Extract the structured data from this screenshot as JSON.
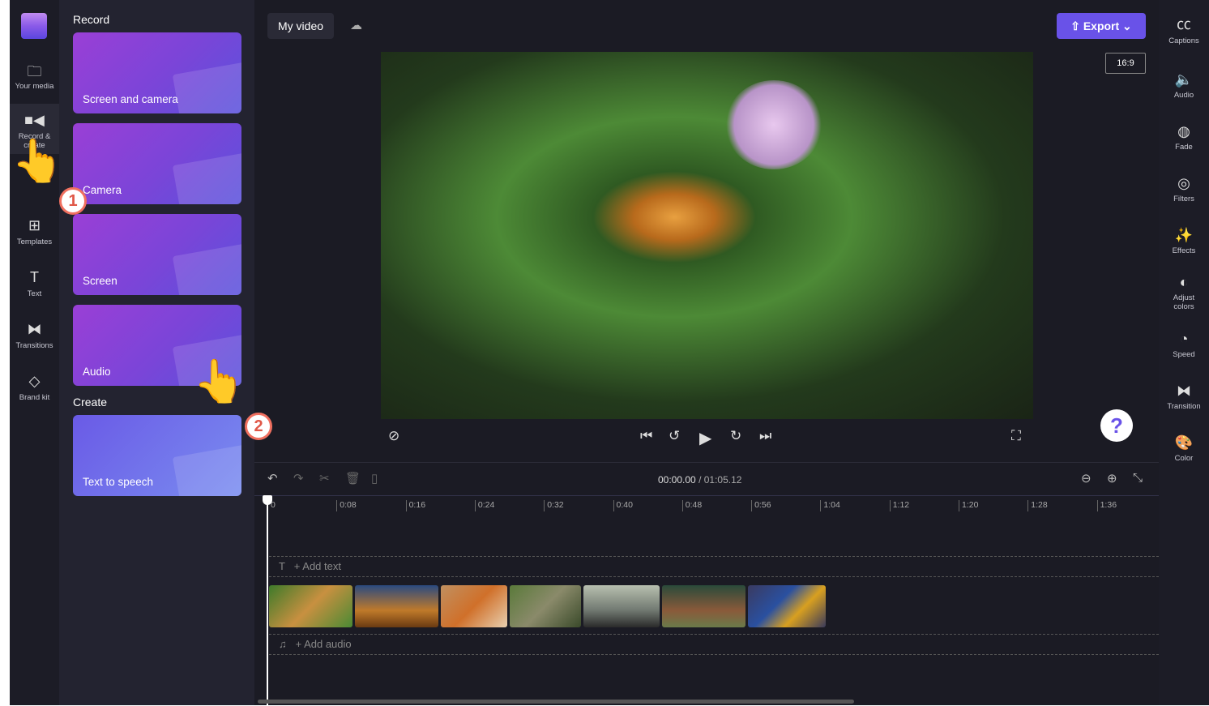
{
  "left_rail": {
    "items": [
      {
        "label": "Your media",
        "icon": "folder-icon"
      },
      {
        "label": "Record & create",
        "icon": "video-camera-icon"
      },
      {
        "label": "Templates",
        "icon": "templates-icon"
      },
      {
        "label": "Text",
        "icon": "text-icon"
      },
      {
        "label": "Transitions",
        "icon": "transitions-icon"
      },
      {
        "label": "Brand kit",
        "icon": "brand-kit-icon"
      }
    ]
  },
  "panel": {
    "record_heading": "Record",
    "record_cards": [
      "Screen and camera",
      "Camera",
      "Screen",
      "Audio"
    ],
    "create_heading": "Create",
    "create_cards": [
      "Text to speech"
    ]
  },
  "header": {
    "project_name": "My video",
    "export_label": "Export",
    "aspect_ratio": "16:9"
  },
  "timeline": {
    "current_time": "00:00.00",
    "total_time": "/ 01:05.12",
    "ticks": [
      "0",
      "0:08",
      "0:16",
      "0:24",
      "0:32",
      "0:40",
      "0:48",
      "0:56",
      "1:04",
      "1:12",
      "1:20",
      "1:28",
      "1:36"
    ],
    "add_text": "+ Add text",
    "add_audio": "+ Add audio"
  },
  "right_rail": {
    "items": [
      "Captions",
      "Audio",
      "Fade",
      "Filters",
      "Effects",
      "Adjust colors",
      "Speed",
      "Transition",
      "Color"
    ]
  },
  "help": "?",
  "annotations": [
    "1",
    "2"
  ],
  "colors": {
    "accent": "#6952e8",
    "background": "#1b1b24"
  }
}
